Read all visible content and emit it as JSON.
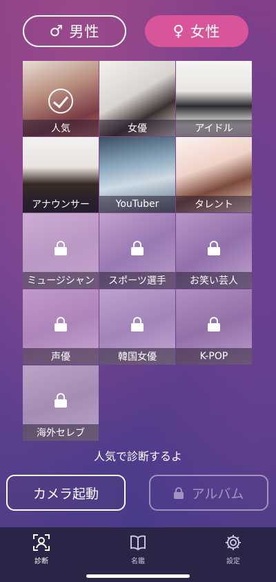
{
  "gender": {
    "male": {
      "symbol": "♂",
      "label": "男性"
    },
    "female": {
      "symbol": "♀",
      "label": "女性"
    }
  },
  "categories": [
    {
      "label": "人気",
      "state": "selected"
    },
    {
      "label": "女優",
      "state": "unlocked"
    },
    {
      "label": "アイドル",
      "state": "unlocked"
    },
    {
      "label": "アナウンサー",
      "state": "unlocked"
    },
    {
      "label": "YouTuber",
      "state": "unlocked"
    },
    {
      "label": "タレント",
      "state": "unlocked"
    },
    {
      "label": "ミュージシャン",
      "state": "locked"
    },
    {
      "label": "スポーツ選手",
      "state": "locked"
    },
    {
      "label": "お笑い芸人",
      "state": "locked"
    },
    {
      "label": "声優",
      "state": "locked"
    },
    {
      "label": "韓国女優",
      "state": "locked"
    },
    {
      "label": "K-POP",
      "state": "locked"
    },
    {
      "label": "海外セレブ",
      "state": "locked"
    }
  ],
  "caption": "人気で診断するよ",
  "actions": {
    "camera": "カメラ起動",
    "album": "アルバム"
  },
  "tabs": [
    {
      "label": "診断",
      "icon": "person-frame-icon"
    },
    {
      "label": "名鑑",
      "icon": "book-icon"
    },
    {
      "label": "設定",
      "icon": "gear-icon"
    }
  ],
  "colors": {
    "accent": "#d9559a",
    "tabbar": "#2a2447"
  }
}
